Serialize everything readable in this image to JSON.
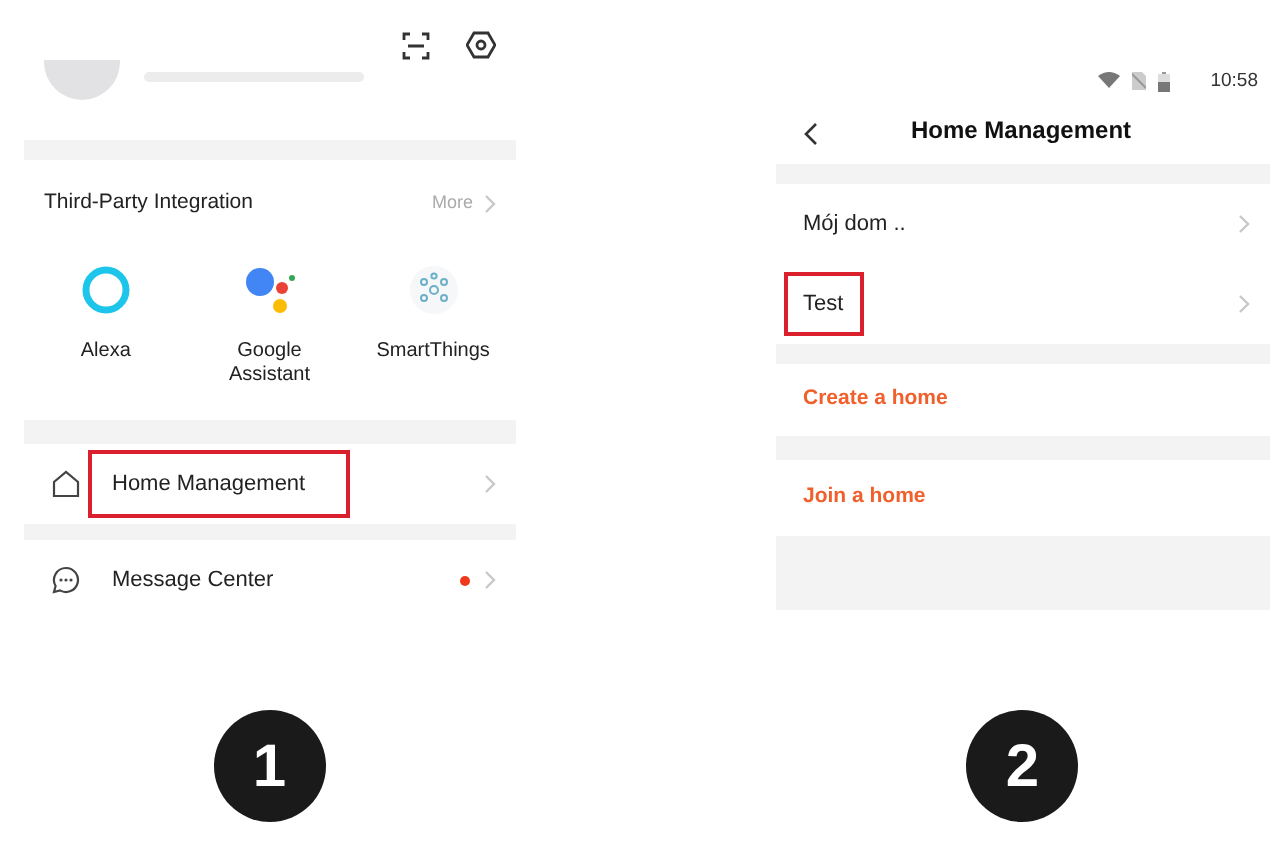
{
  "left": {
    "section_title": "Third-Party Integration",
    "more_link": "More",
    "integrations": [
      {
        "label": "Alexa"
      },
      {
        "label": "Google Assistant"
      },
      {
        "label": "SmartThings"
      }
    ],
    "menu": [
      {
        "label": "Home Management",
        "highlighted": true,
        "unread": false
      },
      {
        "label": "Message Center",
        "highlighted": false,
        "unread": true
      }
    ],
    "step": "1"
  },
  "right": {
    "status_time": "10:58",
    "title": "Home Management",
    "homes": [
      {
        "name": "Mój dom ..",
        "highlighted": false
      },
      {
        "name": "Test",
        "highlighted": true
      }
    ],
    "actions": [
      "Create a home",
      "Join a home"
    ],
    "step": "2"
  }
}
